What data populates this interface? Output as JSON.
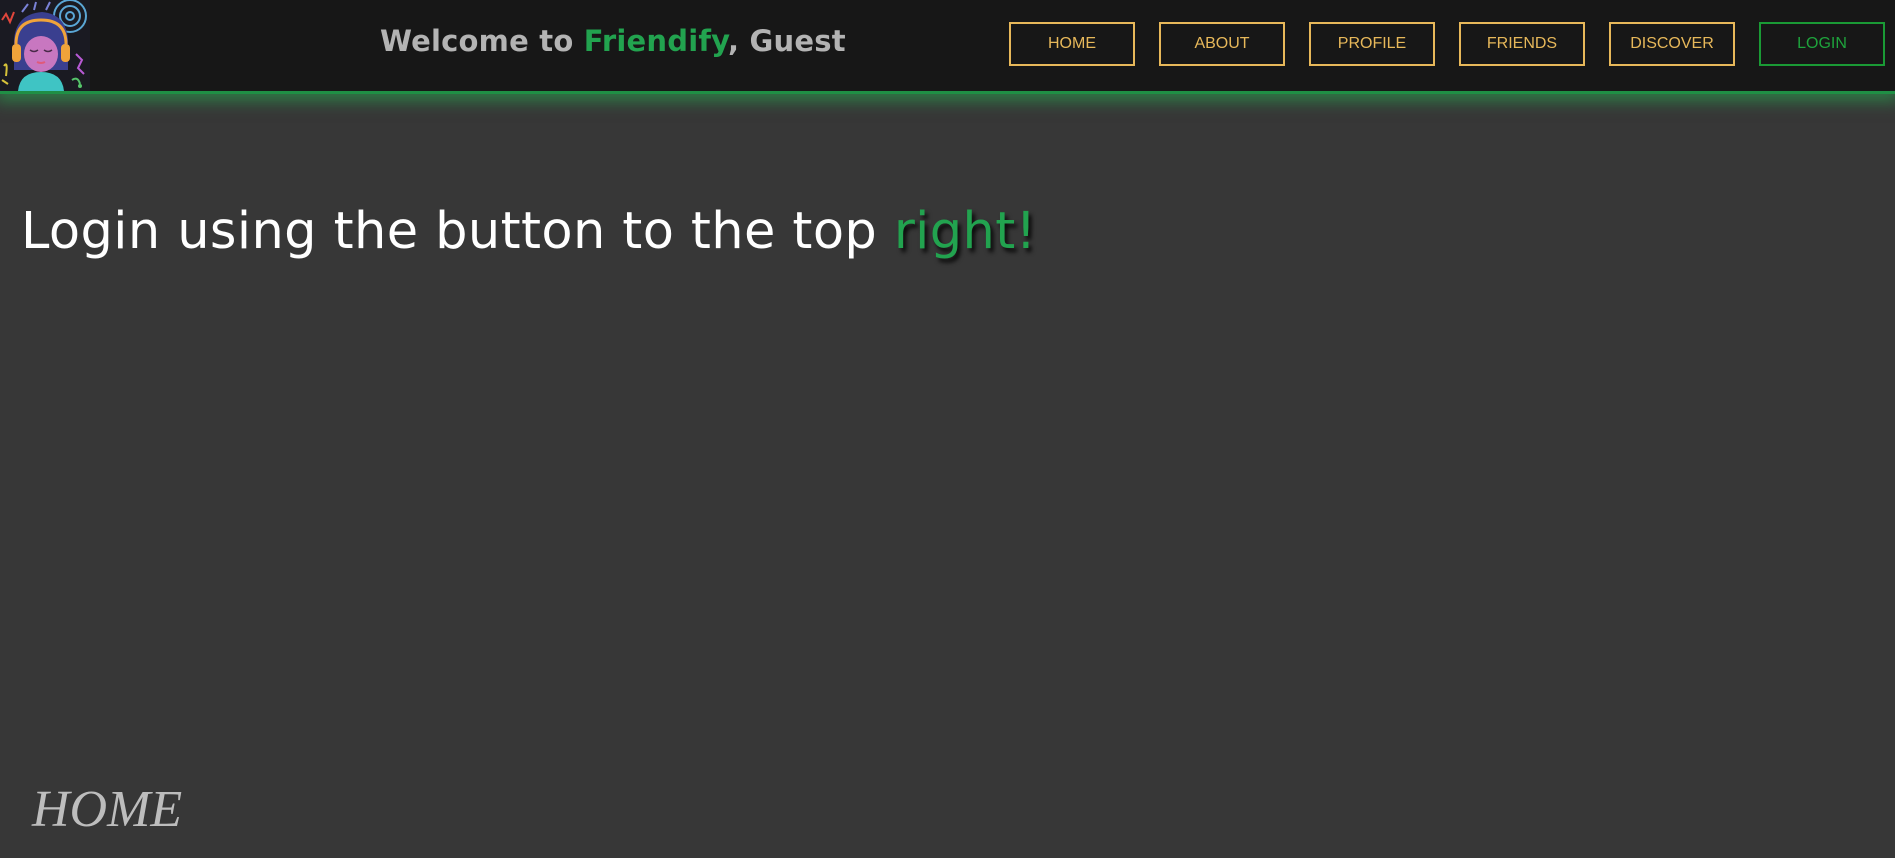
{
  "header": {
    "welcome_prefix": "Welcome to ",
    "brand_name": "Friendify",
    "welcome_suffix": ", Guest",
    "logo_icon": "music-girl-headphones-logo"
  },
  "nav": {
    "items": [
      {
        "label": "HOME"
      },
      {
        "label": "ABOUT"
      },
      {
        "label": "PROFILE"
      },
      {
        "label": "FRIENDS"
      },
      {
        "label": "DISCOVER"
      },
      {
        "label": "LOGIN"
      }
    ]
  },
  "main": {
    "heading_prefix": "Login using the button to the top ",
    "heading_accent": "right!"
  },
  "footer": {
    "page_label": "HOME"
  },
  "colors": {
    "background": "#373737",
    "header_background": "#171717",
    "brand_green": "#22a34f",
    "nav_gold": "#e7b85a",
    "login_green": "#1ea33c"
  }
}
